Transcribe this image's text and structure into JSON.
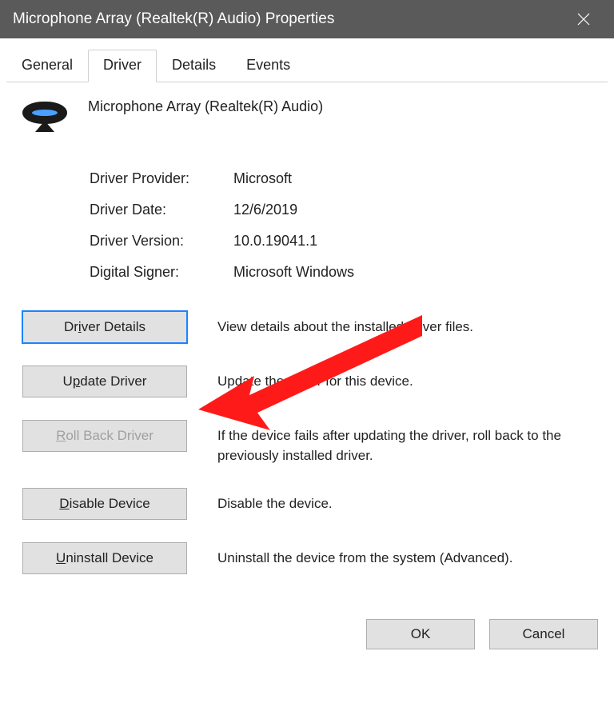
{
  "window": {
    "title": "Microphone Array (Realtek(R) Audio) Properties"
  },
  "tabs": {
    "general": "General",
    "driver": "Driver",
    "details": "Details",
    "events": "Events"
  },
  "device": {
    "name": "Microphone Array (Realtek(R) Audio)"
  },
  "info": {
    "provider_label": "Driver Provider:",
    "provider_value": "Microsoft",
    "date_label": "Driver Date:",
    "date_value": "12/6/2019",
    "version_label": "Driver Version:",
    "version_value": "10.0.19041.1",
    "signer_label": "Digital Signer:",
    "signer_value": "Microsoft Windows"
  },
  "actions": {
    "details": {
      "label_pre": "Dr",
      "label_u": "i",
      "label_post": "ver Details",
      "desc": "View details about the installed driver files."
    },
    "update": {
      "label_pre": "U",
      "label_u": "p",
      "label_post": "date Driver",
      "desc": "Update the driver for this device."
    },
    "rollback": {
      "label_pre": "",
      "label_u": "R",
      "label_post": "oll Back Driver",
      "desc": "If the device fails after updating the driver, roll back to the previously installed driver."
    },
    "disable": {
      "label_pre": "",
      "label_u": "D",
      "label_post": "isable Device",
      "desc": "Disable the device."
    },
    "uninstall": {
      "label_pre": "",
      "label_u": "U",
      "label_post": "ninstall Device",
      "desc": "Uninstall the device from the system (Advanced)."
    }
  },
  "footer": {
    "ok": "OK",
    "cancel": "Cancel"
  }
}
